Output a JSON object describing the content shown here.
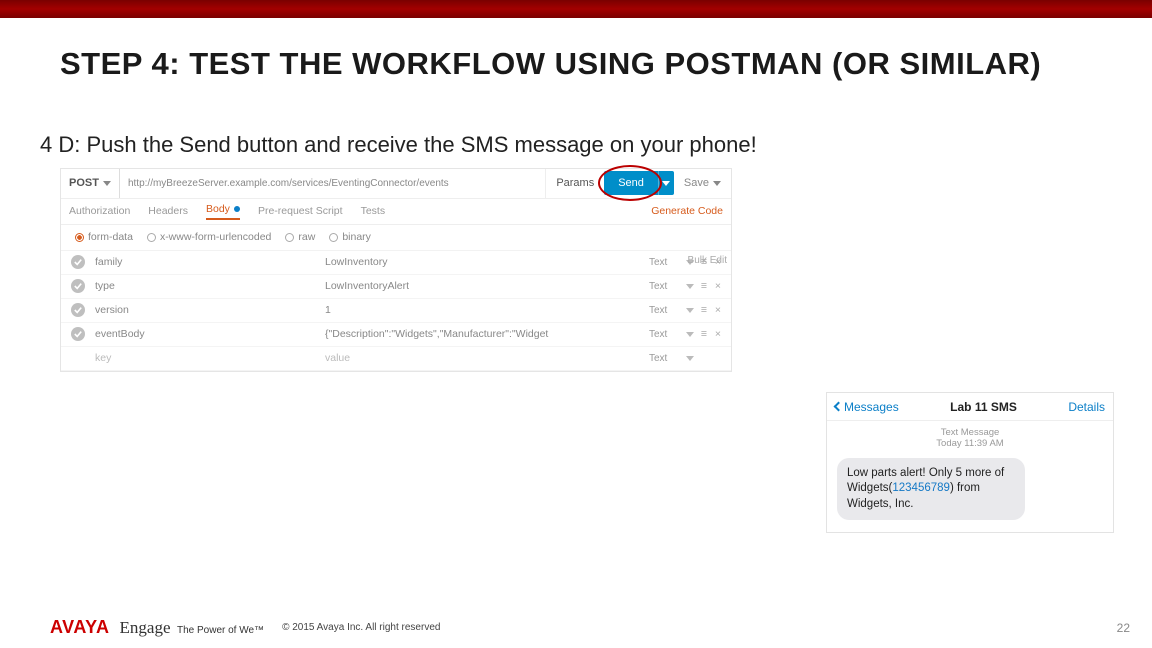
{
  "slide": {
    "title": "STEP 4: TEST THE WORKFLOW USING POSTMAN (OR SIMILAR)",
    "subtitle": "4 D: Push the Send button and receive the SMS message on your phone!",
    "page_number": "22"
  },
  "postman": {
    "method": "POST",
    "url": "http://myBreezeServer.example.com/services/EventingConnector/events",
    "params_label": "Params",
    "send_label": "Send",
    "save_label": "Save",
    "tabs": {
      "auth": "Authorization",
      "headers": "Headers",
      "body": "Body",
      "prereq": "Pre-request Script",
      "tests": "Tests"
    },
    "generate_code": "Generate Code",
    "body_types": {
      "form_data": "form-data",
      "urlencoded": "x-www-form-urlencoded",
      "raw": "raw",
      "binary": "binary"
    },
    "bulk_edit": "Bulk Edit",
    "col_text": "Text",
    "rows": [
      {
        "key": "family",
        "value": "LowInventory"
      },
      {
        "key": "type",
        "value": "LowInventoryAlert"
      },
      {
        "key": "version",
        "value": "1"
      },
      {
        "key": "eventBody",
        "value": "{\"Description\":\"Widgets\",\"Manufacturer\":\"Widget"
      }
    ],
    "placeholder_key": "key",
    "placeholder_value": "value"
  },
  "phone": {
    "back": "Messages",
    "title": "Lab 11 SMS",
    "details": "Details",
    "meta1": "Text Message",
    "meta2": "Today 11:39 AM",
    "msg_pre": "Low parts alert! Only 5 more of Widgets(",
    "msg_num": "123456789",
    "msg_post": ") from Widgets, Inc."
  },
  "footer": {
    "avaya": "AVAYA",
    "engage": "Engage",
    "power": "The Power of We™",
    "copyright": "© 2015 Avaya Inc. All right reserved"
  }
}
